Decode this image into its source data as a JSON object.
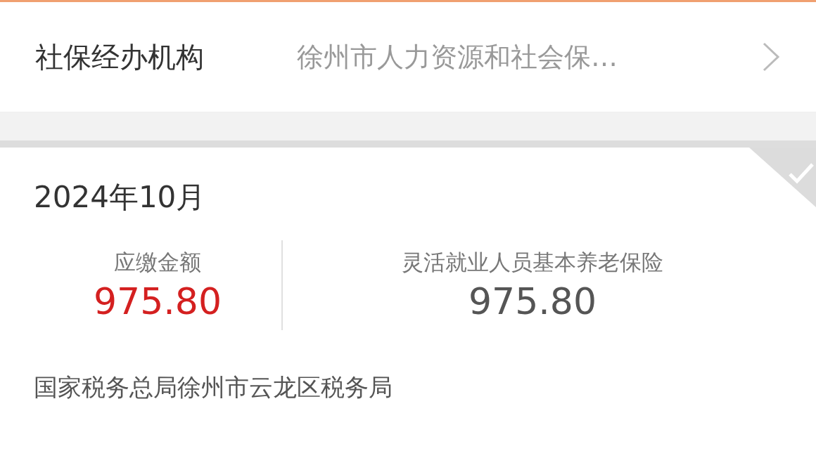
{
  "institution": {
    "label": "社保经办机构",
    "value": "徐州市人力资源和社会保…"
  },
  "record": {
    "period": "2024年10月",
    "paid": true,
    "amount_due": {
      "label": "应缴金额",
      "value": "975.80"
    },
    "item": {
      "label": "灵活就业人员基本养老保险",
      "value": "975.80"
    },
    "tax_authority": "国家税务总局徐州市云龙区税务局"
  }
}
